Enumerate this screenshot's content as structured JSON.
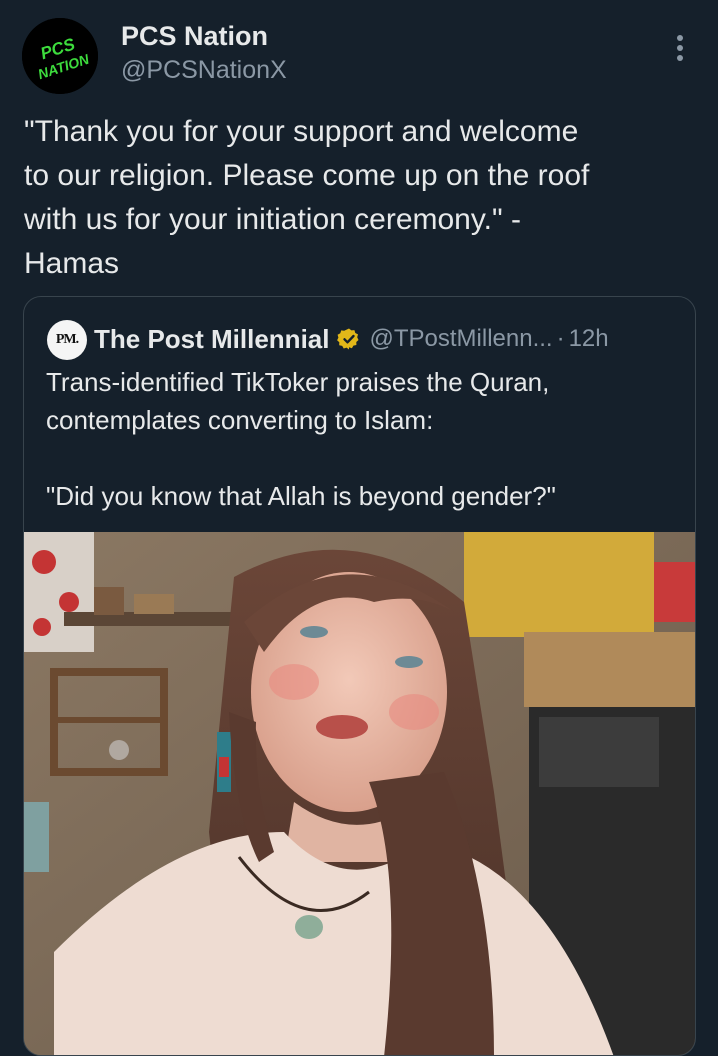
{
  "post": {
    "author_name": "PCS Nation",
    "author_handle": "@PCSNationX",
    "avatar_text_line1": "PCS",
    "avatar_text_line2": "NATION",
    "text": "\"Thank you for your support and welcome\nto our religion. Please come up on the roof\nwith us for your initiation ceremony.\" -\nHamas",
    "more_icon": "more-vertical-icon"
  },
  "quoted": {
    "logo_text": "PM.",
    "author_name": "The Post Millennial",
    "author_handle": "@TPostMillenn...",
    "separator": "·",
    "time": "12h",
    "verified_icon": "verified-gold-badge-icon",
    "text": "Trans-identified TikToker praises the Quran,\ncontemplates converting to Islam:\n\n\"Did you know that Allah is beyond gender?\"",
    "media_type": "video-thumbnail"
  },
  "colors": {
    "background": "#15202b",
    "text_primary": "#e7e9ea",
    "text_secondary": "#8b98a5",
    "border": "#38444d",
    "verified_gold": "#e2b719",
    "avatar_text": "#3ddc3d"
  }
}
